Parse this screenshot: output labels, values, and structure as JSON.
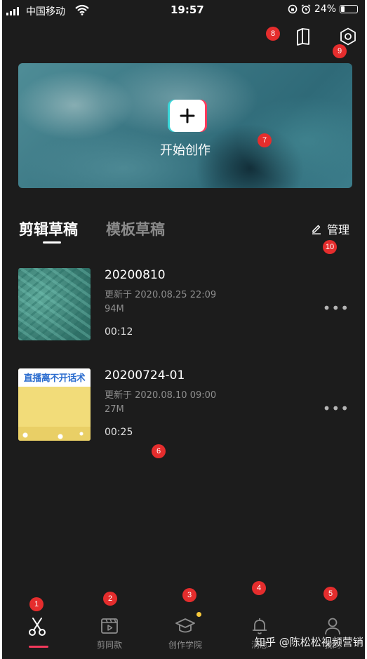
{
  "status_bar": {
    "carrier": "中国移动",
    "time": "19:57",
    "battery": "24%"
  },
  "banner": {
    "create_label": "开始创作"
  },
  "tabs": [
    {
      "label": "剪辑草稿",
      "active": true
    },
    {
      "label": "模板草稿",
      "active": false
    }
  ],
  "manage_label": "管理",
  "drafts": [
    {
      "title": "20200810",
      "updated": "更新于 2020.08.25 22:09",
      "size": "94M",
      "duration": "00:12"
    },
    {
      "title": "20200724-01",
      "updated": "更新于 2020.08.10 09:00",
      "size": "27M",
      "duration": "00:25",
      "thumb_caption": "直播离不开话术"
    }
  ],
  "bottom_nav": [
    {
      "label": "",
      "icon": "scissors-icon",
      "active": true
    },
    {
      "label": "剪同款",
      "icon": "clapperboard-icon"
    },
    {
      "label": "创作学院",
      "icon": "graduation-cap-icon",
      "dot": true
    },
    {
      "label": "消息",
      "icon": "bell-icon"
    },
    {
      "label": "我的",
      "icon": "profile-icon"
    }
  ],
  "annotations": [
    "1",
    "2",
    "3",
    "4",
    "5",
    "6",
    "7",
    "8",
    "9",
    "10"
  ],
  "watermark": "知乎 @陈松松视频营销",
  "colors": {
    "background": "#1c1c1c",
    "accent": "#f2395b",
    "badge": "#e52d2d",
    "notification_dot": "#f7c83b"
  }
}
